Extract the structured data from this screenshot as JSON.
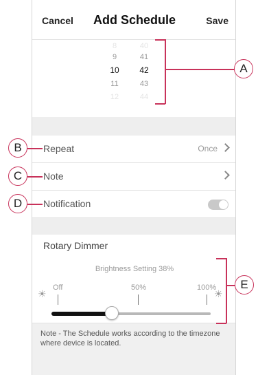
{
  "header": {
    "cancel_label": "Cancel",
    "title": "Add Schedule",
    "save_label": "Save"
  },
  "time_picker": {
    "hours": [
      "8",
      "9",
      "10",
      "11",
      "12"
    ],
    "minutes": [
      "40",
      "41",
      "42",
      "43",
      "44"
    ],
    "selected_hour": "10",
    "selected_minute": "42"
  },
  "settings": {
    "repeat": {
      "label": "Repeat",
      "value": "Once"
    },
    "note": {
      "label": "Note"
    },
    "notification": {
      "label": "Notification",
      "enabled": true
    }
  },
  "dimmer": {
    "title": "Rotary Dimmer",
    "brightness_label": "Brightness Setting 38%",
    "brightness_fraction": 0.38,
    "tick_off": "Off",
    "tick_mid": "50%",
    "tick_max": "100%"
  },
  "note_text": "Note - The Schedule works according to the timezone where device is located.",
  "callouts": {
    "a": "A",
    "b": "B",
    "c": "C",
    "d": "D",
    "e": "E"
  },
  "colors": {
    "callout": "#c8325a",
    "slider_fill": "#111111",
    "slider_track": "#b8b8b8"
  }
}
